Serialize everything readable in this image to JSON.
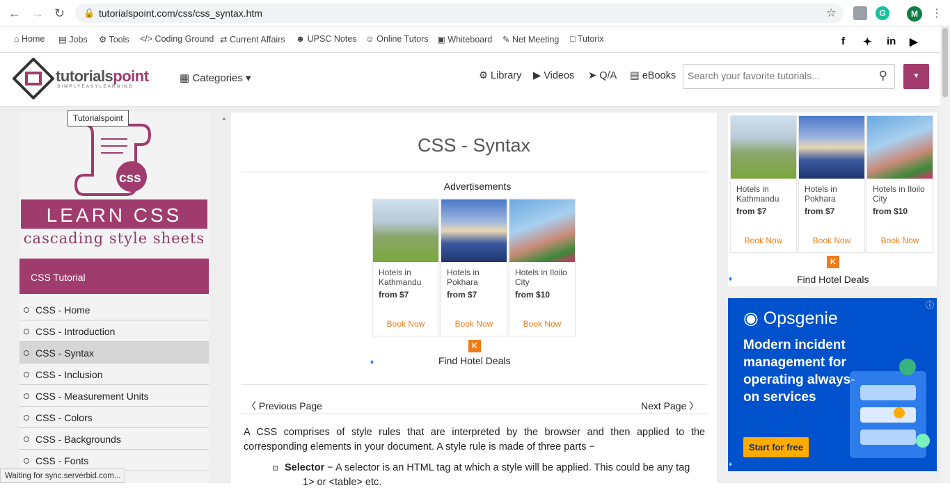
{
  "browser": {
    "url": "tutorialspoint.com/css/css_syntax.htm",
    "profile_initial": "M",
    "ext_initial": "G"
  },
  "topnav": {
    "items": [
      "Home",
      "Jobs",
      "Tools",
      "Coding Ground",
      "Current Affairs",
      "UPSC Notes",
      "Online Tutors",
      "Whiteboard",
      "Net Meeting",
      "Tutorix"
    ]
  },
  "header": {
    "brand_main": "tutorials",
    "brand_accent": "point",
    "brand_tagline": "SIMPLYEASYLEARNING",
    "categories": "Categories",
    "links": [
      "Library",
      "Videos",
      "Q/A",
      "eBooks"
    ],
    "search_placeholder": "Search your favorite tutorials..."
  },
  "sidebar": {
    "tooltip": "Tutorialspoint",
    "learn_line1": "LEARN CSS",
    "learn_line2": "cascading style sheets",
    "logo_text": "css",
    "title": "CSS Tutorial",
    "items": [
      "CSS - Home",
      "CSS - Introduction",
      "CSS - Syntax",
      "CSS - Inclusion",
      "CSS - Measurement Units",
      "CSS - Colors",
      "CSS - Backgrounds",
      "CSS - Fonts"
    ],
    "active_index": 2
  },
  "main": {
    "title": "CSS - Syntax",
    "ads_label": "Advertisements",
    "prev": "Previous Page",
    "next": "Next Page",
    "paragraph": "A CSS comprises of style rules that are interpreted by the browser and then applied to the corresponding elements in your document. A style rule is made of three parts −",
    "bullet_term": "Selector",
    "bullet_text": " − A selector is an HTML tag at which a style will be applied. This could be any tag",
    "bullet_text2": "1> or <table> etc."
  },
  "ads": {
    "hotels": [
      {
        "name": "Hotels in Kathmandu",
        "price": "from $7",
        "cta": "Book Now"
      },
      {
        "name": "Hotels in Pokhara",
        "price": "from $7",
        "cta": "Book Now"
      },
      {
        "name": "Hotels in Iloilo City",
        "price": "from $10",
        "cta": "Book Now"
      }
    ],
    "badge": "K",
    "find_deals": "Find Hotel Deals",
    "opsgenie": {
      "brand": "Opsgenie",
      "headline": "Modern incident management for operating always-on services",
      "cta": "Start for free"
    }
  },
  "status": "Waiting for sync.serverbid.com...",
  "colors": {
    "brand": "#a03c6d",
    "cta_orange": "#f07c1a",
    "ops_blue": "#0052cc"
  }
}
